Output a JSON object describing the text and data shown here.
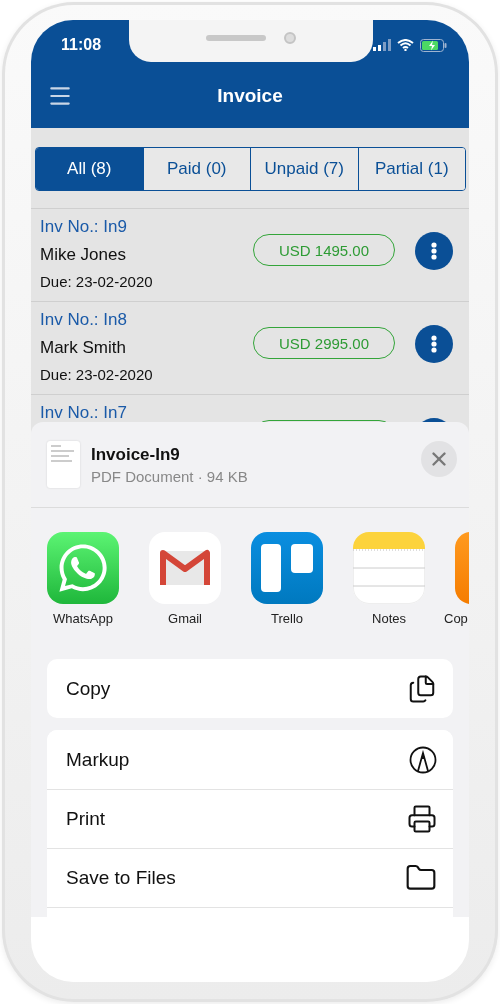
{
  "status_bar": {
    "time": "11:08"
  },
  "header": {
    "title": "Invoice"
  },
  "tabs": [
    {
      "label": "All (8)",
      "selected": true
    },
    {
      "label": "Paid (0)",
      "selected": false
    },
    {
      "label": "Unpaid (7)",
      "selected": false
    },
    {
      "label": "Partial (1)",
      "selected": false
    }
  ],
  "invoices": [
    {
      "number": "Inv No.: In9",
      "customer": "Mike Jones",
      "due": "Due: 23-02-2020",
      "amount": "USD 1495.00"
    },
    {
      "number": "Inv No.: In8",
      "customer": "Mark Smith",
      "due": "Due: 23-02-2020",
      "amount": "USD 2995.00"
    },
    {
      "number": "Inv No.: In7"
    }
  ],
  "share_sheet": {
    "file": {
      "name": "Invoice-In9",
      "details": "PDF Document · 94 KB"
    },
    "apps": [
      {
        "label": "WhatsApp",
        "kind": "whatsapp"
      },
      {
        "label": "Gmail",
        "kind": "gmail"
      },
      {
        "label": "Trello",
        "kind": "trello"
      },
      {
        "label": "Notes",
        "kind": "notes"
      },
      {
        "label": "Cop",
        "kind": "orange"
      }
    ],
    "actions": [
      {
        "label": "Copy",
        "kind": "copy"
      }
    ],
    "action_group": [
      {
        "label": "Markup",
        "kind": "markup"
      },
      {
        "label": "Print",
        "kind": "print"
      },
      {
        "label": "Save to Files",
        "kind": "files"
      }
    ]
  }
}
